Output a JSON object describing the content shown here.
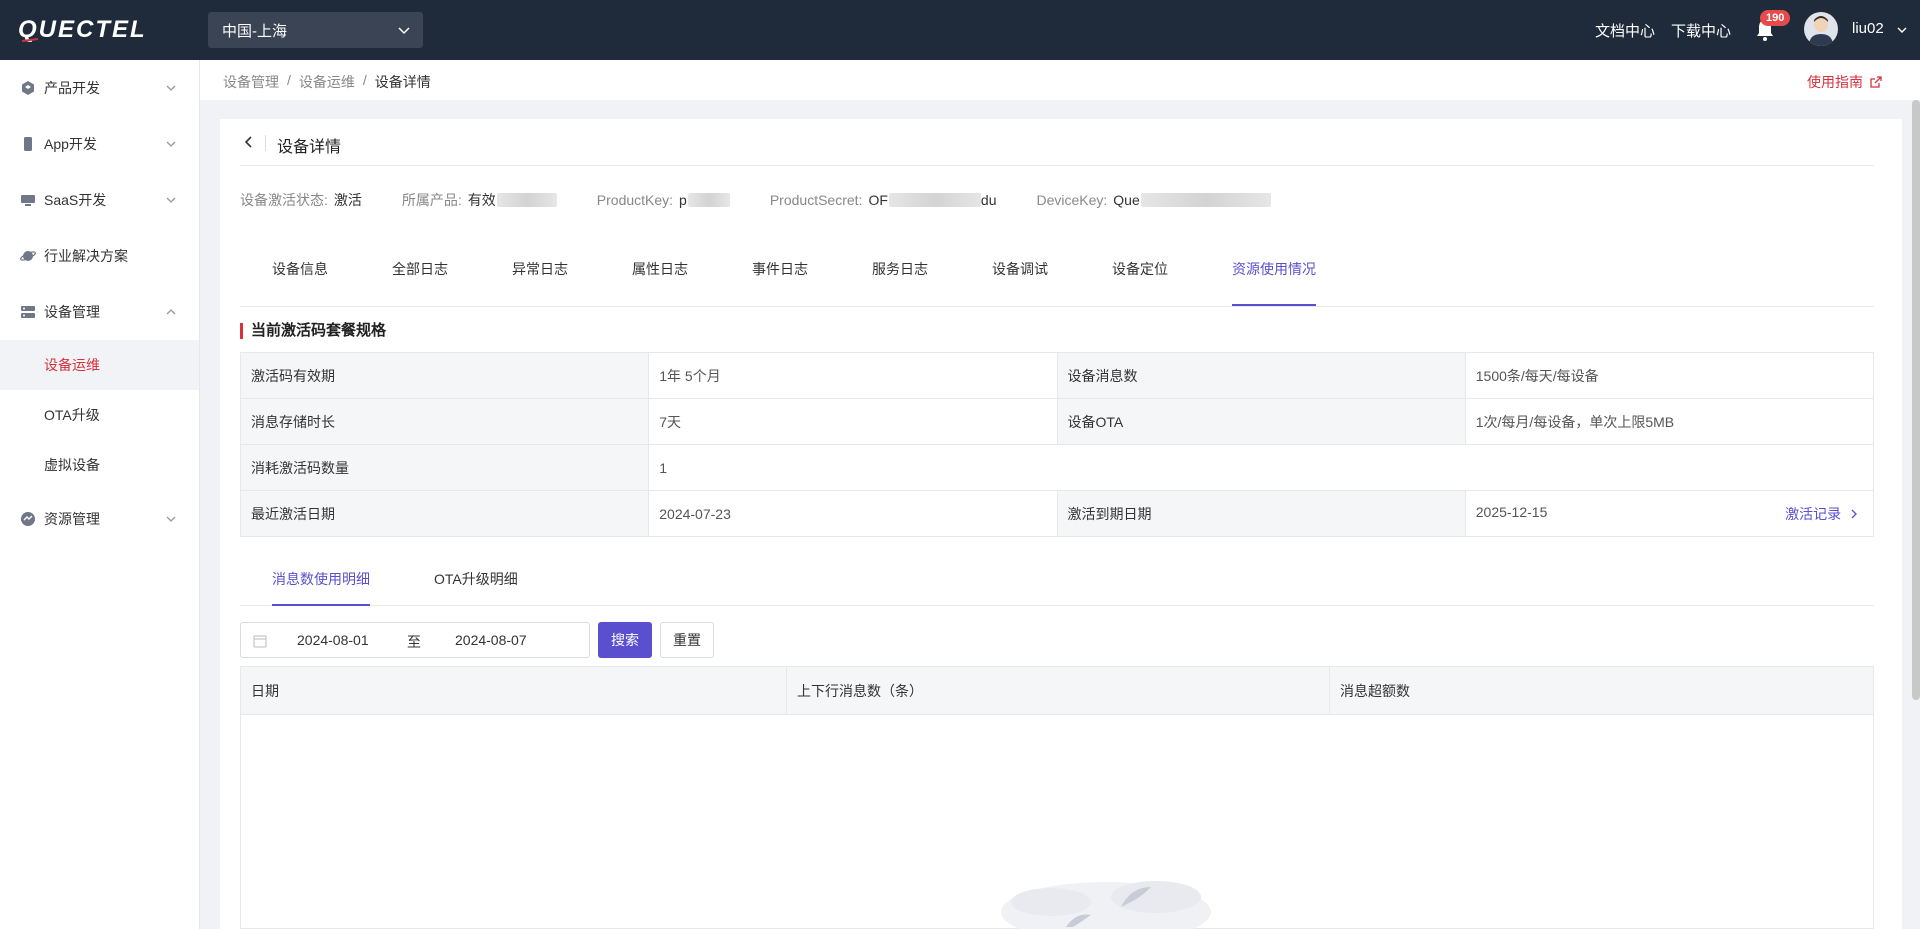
{
  "header": {
    "logo_text": "QUECTEL",
    "region": "中国-上海",
    "docs_link": "文档中心",
    "download_link": "下载中心",
    "notification_count": "190",
    "username": "liu02"
  },
  "sidebar": {
    "items": [
      {
        "label": "产品开发",
        "icon": "cube-icon"
      },
      {
        "label": "App开发",
        "icon": "phone-icon"
      },
      {
        "label": "SaaS开发",
        "icon": "monitor-icon"
      },
      {
        "label": "行业解决方案",
        "icon": "planet-icon"
      },
      {
        "label": "设备管理",
        "icon": "server-icon"
      },
      {
        "label": "资源管理",
        "icon": "resource-icon"
      }
    ],
    "device_sub": [
      "设备运维",
      "OTA升级",
      "虚拟设备"
    ],
    "active_sub": "设备运维"
  },
  "breadcrumb": [
    "设备管理",
    "设备运维",
    "设备详情"
  ],
  "guide_link": "使用指南",
  "page": {
    "title": "设备详情",
    "info": [
      {
        "label": "设备激活状态:",
        "value": "激活"
      },
      {
        "label": "所属产品:",
        "value": "有效"
      },
      {
        "label": "ProductKey:",
        "value": "p"
      },
      {
        "label": "ProductSecret:",
        "value": "OF",
        "suffix": "du"
      },
      {
        "label": "DeviceKey:",
        "value": "Que"
      }
    ],
    "tabs": [
      "设备信息",
      "全部日志",
      "异常日志",
      "属性日志",
      "事件日志",
      "服务日志",
      "设备调试",
      "设备定位",
      "资源使用情况"
    ],
    "active_tab": "资源使用情况"
  },
  "spec": {
    "section_title": "当前激活码套餐规格",
    "rows": [
      [
        "激活码有效期",
        "1年 5个月",
        "设备消息数",
        "1500条/每天/每设备"
      ],
      [
        "消息存储时长",
        "7天",
        "设备OTA",
        "1次/每月/每设备，单次上限5MB"
      ],
      [
        "消耗激活码数量",
        "1"
      ],
      [
        "最近激活日期",
        "2024-07-23",
        "激活到期日期",
        "2025-12-15"
      ]
    ],
    "activation_link": "激活记录"
  },
  "usage": {
    "subtabs": [
      "消息数使用明细",
      "OTA升级明细"
    ],
    "active_subtab": "消息数使用明细",
    "start_date": "2024-08-01",
    "range_sep": "至",
    "end_date": "2024-08-07",
    "search_label": "搜索",
    "reset_label": "重置",
    "columns": [
      "日期",
      "上下行消息数（条）",
      "消息超额数"
    ]
  },
  "colors": {
    "topbar": "#1f2a3b",
    "accent": "#5a4fcf",
    "brand_red": "#d4323c",
    "badge": "#e64a4a"
  }
}
